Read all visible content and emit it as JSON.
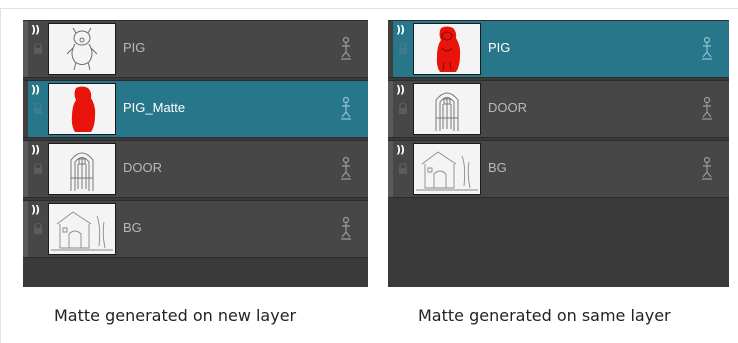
{
  "panels": [
    {
      "caption": "Matte generated on new layer",
      "layers": [
        {
          "name": "PIG",
          "selected": false,
          "thumb": "pig-sketch-icon"
        },
        {
          "name": "PIG_Matte",
          "selected": true,
          "thumb": "pig-matte-icon"
        },
        {
          "name": "DOOR",
          "selected": false,
          "thumb": "door-icon"
        },
        {
          "name": "BG",
          "selected": false,
          "thumb": "background-icon"
        }
      ]
    },
    {
      "caption": "Matte generated on same layer",
      "layers": [
        {
          "name": "PIG",
          "selected": true,
          "thumb": "pig-matte-icon"
        },
        {
          "name": "DOOR",
          "selected": false,
          "thumb": "door-icon"
        },
        {
          "name": "BG",
          "selected": false,
          "thumb": "background-icon"
        }
      ]
    }
  ],
  "icons": {
    "visibility": "eye-icon",
    "lock": "lock-icon",
    "peg": "peg-icon"
  },
  "colors": {
    "selected_row": "#287689",
    "row": "#474747",
    "panel": "#3a3a3a",
    "matte_fill": "#e8140c"
  }
}
